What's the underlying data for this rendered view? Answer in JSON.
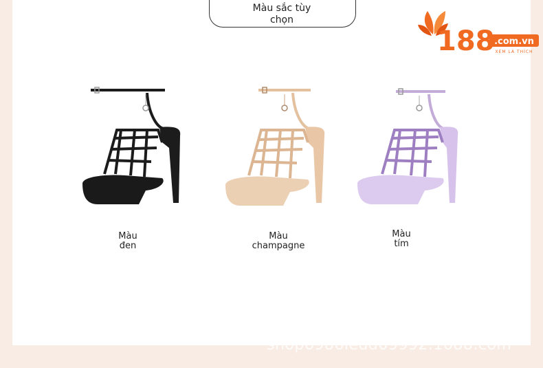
{
  "header": {
    "title_line1": "Màu sắc tùy",
    "title_line2": "chọn"
  },
  "logo": {
    "brand_number": "188",
    "brand_domain": ".com.vn",
    "tagline": "XEM LÀ THÍCH"
  },
  "products": [
    {
      "label_line1": "Màu",
      "label_line2": "đen",
      "color": "#1c1c1c"
    },
    {
      "label_line1": "Màu",
      "label_line2": "champagne",
      "color": "#e9c7a6"
    },
    {
      "label_line1": "Màu",
      "label_line2": "tím",
      "color": "#c7b0dd"
    }
  ],
  "watermark": "shop6986ledd09992.1688.com",
  "colors": {
    "background": "#f9ece4",
    "panel": "#ffffff",
    "brand_orange": "#f06a22"
  }
}
